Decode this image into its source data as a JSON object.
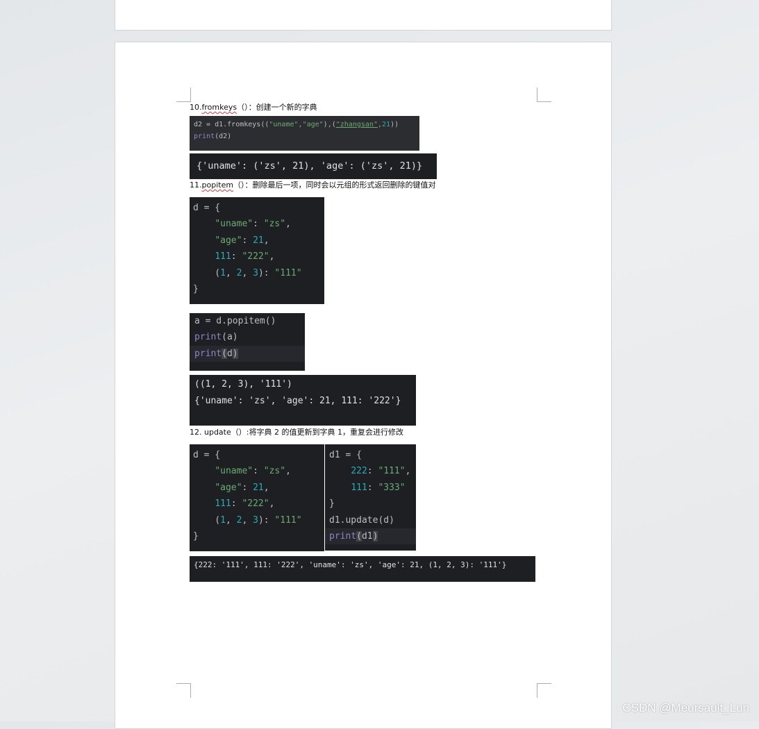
{
  "headings": {
    "h10_prefix": "10.",
    "h10_method": "fromkeys",
    "h10_rest": "（）：创建一个新的字典",
    "h11_prefix": "11.",
    "h11_method": "popitem",
    "h11_rest": "（）：删除最后一项，同时会以元组的形式返回删除的键值对",
    "h12_prefix": "12. ",
    "h12_method": "update",
    "h12_rest": "（）:将字典 2 的值更新到字典 1，重复会进行修改"
  },
  "code1": {
    "line1_a": "d2 = d1.fromkeys((",
    "line1_s1": "\"uname\"",
    "line1_c1": ",",
    "line1_s2": "\"age\"",
    "line1_b": ")",
    "line1_c2": ",",
    "line1_p": "(",
    "line1_s3": "\"zhangsan\"",
    "line1_c3": ",",
    "line1_n": "21",
    "line1_end": "))",
    "line2_f": "print",
    "line2_rest": "(d2)"
  },
  "output1": "{'uname': ('zs', 21), 'age': ('zs', 21)}",
  "code_dict": {
    "open": "d = {",
    "k1": "\"uname\"",
    "v1": "\"zs\"",
    "k2": "\"age\"",
    "v2": "21",
    "k3": "111",
    "v3": "\"222\"",
    "t1": "1",
    "t2": "2",
    "t3": "3",
    "v4": "\"111\"",
    "close": "}"
  },
  "code3": {
    "line1": "a = d.popitem()",
    "line2_f": "print",
    "line2_rest": "(a)",
    "line3_f": "print",
    "line3_p1": "(",
    "line3_arg": "d",
    "line3_p2": ")"
  },
  "output2": {
    "line1": "((1, 2, 3), '111')",
    "line2": "{'uname': 'zs', 'age': 21, 111: '222'}"
  },
  "code5": {
    "open": "d1 = {",
    "k1": "222",
    "v1": "\"111\"",
    "k2": "111",
    "v2": "\"333\"",
    "close": "}",
    "line_update": "d1.update(d)",
    "print_f": "print",
    "print_p1": "(",
    "print_arg": "d1",
    "print_p2": ")"
  },
  "output3": "{222: '111', 111: '222', 'uname': 'zs', 'age': 21, (1, 2, 3): '111'}",
  "watermark": "CSDN @Meursault_Lun"
}
